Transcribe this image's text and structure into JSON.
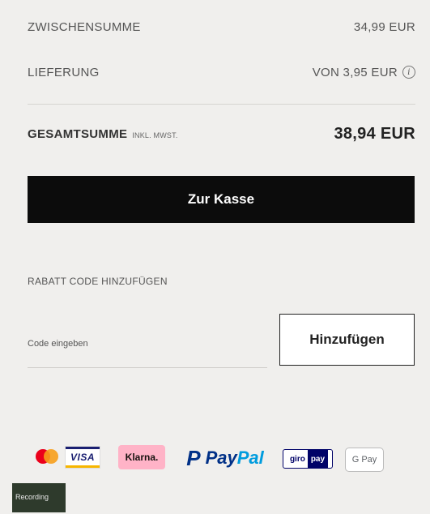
{
  "summary": {
    "subtotal_label": "ZWISCHENSUMME",
    "subtotal_value": "34,99 EUR",
    "delivery_label": "LIEFERUNG",
    "delivery_value": "VON 3,95 EUR",
    "info_icon": "i",
    "total_label": "GESAMTSUMME",
    "total_note": "INKL. MWST.",
    "total_value": "38,94 EUR"
  },
  "checkout": {
    "label": "Zur Kasse"
  },
  "discount": {
    "title": "RABATT CODE HINZUFÜGEN",
    "placeholder": "Code eingeben",
    "value": "",
    "add_label": "Hinzufügen"
  },
  "payments": {
    "visa": "VISA",
    "klarna": "Klarna.",
    "paypal_mark": "P",
    "paypal_pay": "Pay",
    "paypal_pal": "Pal",
    "giropay_a": "giro",
    "giropay_b": "pay",
    "gpay": "G Pay"
  },
  "badge": {
    "line1": "Recording",
    "line2": ""
  },
  "colors": {
    "background": "#f0efed",
    "checkout_bg": "#0c0c0c",
    "paypal_blue": "#003087",
    "paypal_light": "#009cde",
    "klarna_pink": "#ffb3c7",
    "mastercard_red": "#eb001b",
    "mastercard_orange": "#f79e1b"
  },
  "icons": [
    "info-icon",
    "mastercard-logo",
    "visa-logo",
    "klarna-logo",
    "paypal-logo",
    "giropay-logo",
    "google-pay-logo"
  ]
}
